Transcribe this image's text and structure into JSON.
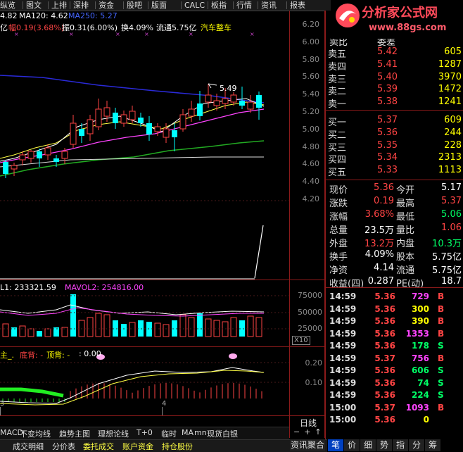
{
  "menu": {
    "items": [
      "纵览",
      "图文",
      "上排",
      "深排",
      "资金",
      "股吧",
      "版面",
      "CALC",
      "板指",
      "行情",
      "资讯",
      "报表"
    ]
  },
  "logo": {
    "title": "分析家公式网",
    "url": "www.88gs.com"
  },
  "indicator_line": {
    "ma60": "4.82",
    "ma120": "MA120: 4.62",
    "ma250": "MA250: 5.27"
  },
  "info_line": {
    "label": "亿",
    "change": "幅0.19(3.68%)",
    "amplitude": "振0.31(6.00%)",
    "turnover": "换4.09%",
    "float": "流通5.75亿",
    "sector": "汽车整车"
  },
  "price_axis": [
    "6.20",
    "6.00",
    "5.80",
    "5.60",
    "5.40",
    "5.20",
    "5.00",
    "4.80",
    "4.60",
    "4.40",
    "4.20"
  ],
  "peak_label": "5.49",
  "volume_line": {
    "vol": "L1: 233321.59",
    "mavol2": "MAVOL2: 254816.00"
  },
  "volume_axis": [
    "75000",
    "50000",
    "25000"
  ],
  "volume_unit": "X10",
  "macd_line": {
    "a": "主_.",
    "bottom": "底背: -",
    "top": "顶背: -",
    "val": ": 0.00"
  },
  "macd_axis": [
    "0.20",
    "0.10"
  ],
  "date_labels": [
    "3",
    "4"
  ],
  "bottom_tabs_row1": [
    "MACD",
    "不变均线",
    "趋势主图",
    "理想论线",
    "T+0",
    "临时",
    "MA",
    "mn",
    "现货白银"
  ],
  "bottom_tabs_row2": [
    "成交明细",
    "分价表",
    "委托成交",
    "账户资金",
    "持仓股份"
  ],
  "period": "日线",
  "quote": {
    "header_left": "卖比",
    "header_right": "委差",
    "sells": [
      {
        "label": "卖五",
        "price": "5.42",
        "vol": "605"
      },
      {
        "label": "卖四",
        "price": "5.41",
        "vol": "1287"
      },
      {
        "label": "卖三",
        "price": "5.40",
        "vol": "3970"
      },
      {
        "label": "卖二",
        "price": "5.39",
        "vol": "1472"
      },
      {
        "label": "卖一",
        "price": "5.38",
        "vol": "1241"
      }
    ],
    "buys": [
      {
        "label": "买一",
        "price": "5.37",
        "vol": "609"
      },
      {
        "label": "买二",
        "price": "5.36",
        "vol": "244"
      },
      {
        "label": "买三",
        "price": "5.35",
        "vol": "228"
      },
      {
        "label": "买四",
        "price": "5.34",
        "vol": "2313"
      },
      {
        "label": "买五",
        "price": "5.33",
        "vol": "1113"
      }
    ]
  },
  "stats": [
    {
      "l1": "现价",
      "v1": "5.36",
      "c1": "#ff4444",
      "l2": "今开",
      "v2": "5.17",
      "c2": "#ffffff"
    },
    {
      "l1": "涨跌",
      "v1": "0.19",
      "c1": "#ff4444",
      "l2": "最高",
      "v2": "5.37",
      "c2": "#ff4444"
    },
    {
      "l1": "涨幅",
      "v1": "3.68%",
      "c1": "#ff4444",
      "l2": "最低",
      "v2": "5.06",
      "c2": "#00ff66"
    },
    {
      "l1": "总量",
      "v1": "23.5万",
      "c1": "#ffffff",
      "l2": "量比",
      "v2": "1.06",
      "c2": "#ff4444"
    },
    {
      "l1": "外盘",
      "v1": "13.2万",
      "c1": "#ff4444",
      "l2": "内盘",
      "v2": "10.3万",
      "c2": "#00ff66"
    },
    {
      "l1": "换手",
      "v1": "4.09%",
      "c1": "#ffffff",
      "l2": "股本",
      "v2": "5.75亿",
      "c2": "#ffffff"
    },
    {
      "l1": "净资",
      "v1": "4.14",
      "c1": "#ffffff",
      "l2": "流通",
      "v2": "5.75亿",
      "c2": "#ffffff"
    },
    {
      "l1": "收益(四)",
      "v1": "0.287",
      "c1": "#ffffff",
      "l2": "PE(动)",
      "v2": "18.7",
      "c2": "#ffffff"
    }
  ],
  "ticks": [
    {
      "time": "14:59",
      "price": "5.36",
      "vol": "729",
      "dir": "B"
    },
    {
      "time": "14:59",
      "price": "5.36",
      "vol": "300",
      "dir": "B"
    },
    {
      "time": "14:59",
      "price": "5.36",
      "vol": "390",
      "dir": "B"
    },
    {
      "time": "14:59",
      "price": "5.36",
      "vol": "1353",
      "dir": "B"
    },
    {
      "time": "14:59",
      "price": "5.36",
      "vol": "178",
      "dir": "S"
    },
    {
      "time": "14:59",
      "price": "5.37",
      "vol": "756",
      "dir": "B"
    },
    {
      "time": "14:59",
      "price": "5.36",
      "vol": "606",
      "dir": "S"
    },
    {
      "time": "14:59",
      "price": "5.36",
      "vol": "74",
      "dir": "S"
    },
    {
      "time": "14:59",
      "price": "5.36",
      "vol": "224",
      "dir": "S"
    },
    {
      "time": "15:00",
      "price": "5.37",
      "vol": "1093",
      "dir": "B"
    },
    {
      "time": "15:00",
      "price": "5.36",
      "vol": "0",
      "dir": ""
    }
  ],
  "right_tabs": [
    "资讯聚合",
    "笔",
    "价",
    "细",
    "势",
    "指",
    "分",
    "筹"
  ],
  "colors": {
    "up": "#ff4444",
    "down": "#00ff66",
    "cyan": "#00ffff",
    "yellow": "#ffff00",
    "magenta": "#ff44ff"
  }
}
